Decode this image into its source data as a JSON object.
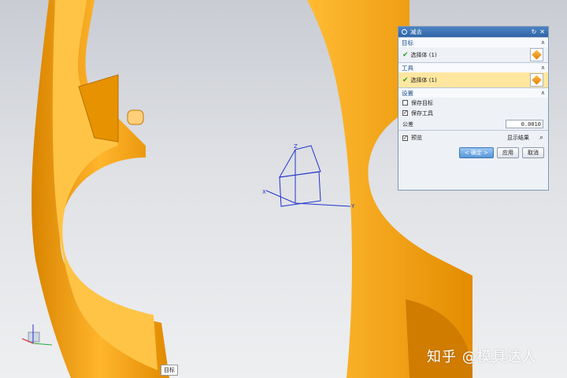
{
  "dialog": {
    "title": "减去",
    "target": {
      "heading": "目标",
      "select_label": "选择体 (1)"
    },
    "tool": {
      "heading": "工具",
      "select_label": "选择体 (1)"
    },
    "settings": {
      "heading": "设置",
      "keep_target": "保存目标",
      "keep_tool": "保存工具",
      "tolerance_label": "公差",
      "tolerance_value": "0.0010"
    },
    "preview": {
      "label": "预览",
      "show_result": "显示结果"
    },
    "buttons": {
      "ok": "< 确定 >",
      "apply": "应用",
      "cancel": "取消"
    }
  },
  "viewport": {
    "axis_labels": {
      "x": "X",
      "y": "Y",
      "z": "Z"
    },
    "tooltip": "目标"
  },
  "watermark": "知乎 @模具达人",
  "colors": {
    "part_orange": "#f5a81c",
    "titlebar": "#3b73b7"
  }
}
